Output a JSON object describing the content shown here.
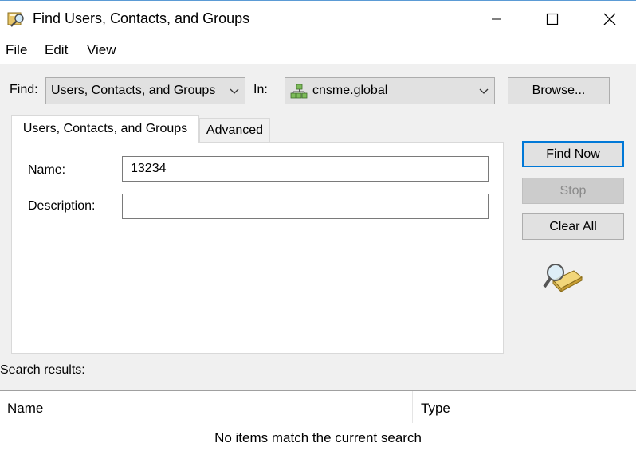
{
  "window": {
    "title": "Find Users, Contacts, and Groups",
    "icons": {
      "app": "find-search-icon",
      "minimize": "minimize-icon",
      "maximize": "maximize-icon",
      "close": "close-icon"
    }
  },
  "menu": {
    "items": [
      "File",
      "Edit",
      "View"
    ]
  },
  "search_bar": {
    "find_label": "Find:",
    "find_value": "Users, Contacts, and Groups",
    "in_label": "In:",
    "in_value": "cnsme.global",
    "in_icon": "domain-icon",
    "browse_label": "Browse..."
  },
  "tabs": [
    {
      "label": "Users, Contacts, and Groups",
      "active": true
    },
    {
      "label": "Advanced",
      "active": false
    }
  ],
  "form": {
    "name_label": "Name:",
    "name_value": "13234",
    "description_label": "Description:",
    "description_value": ""
  },
  "buttons": {
    "find_now": "Find Now",
    "stop": "Stop",
    "clear_all": "Clear All"
  },
  "results": {
    "label": "Search results:",
    "columns": [
      "Name",
      "Type"
    ],
    "empty_message": "No items match the current search"
  },
  "colors": {
    "accent": "#0078d7",
    "window_bg": "#f0f0f0",
    "button_bg": "#e1e1e1"
  }
}
